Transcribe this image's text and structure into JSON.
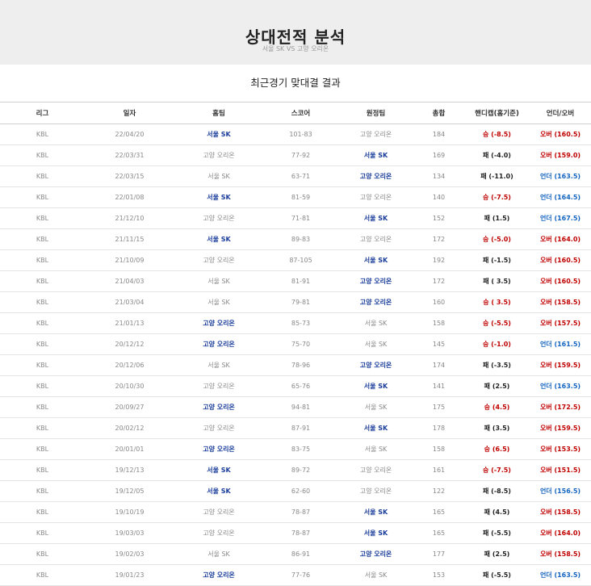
{
  "header": {
    "title": "상대전적 분석",
    "subtitle": "서울 SK VS 고양 오리온"
  },
  "section_title": "최근경기 맞대결 결과",
  "columns": [
    "리그",
    "일자",
    "홈팀",
    "스코어",
    "원정팀",
    "총합",
    "핸디캡(홈기준)",
    "언더/오버"
  ],
  "rows": [
    {
      "league": "KBL",
      "date": "22/04/20",
      "home": "서울 SK",
      "score": "101-83",
      "away": "고양 오리온",
      "total": "184",
      "hc": "승 (-8.5)",
      "ou": "오버 (160.5)",
      "winner": "home",
      "hcw": true,
      "over": true
    },
    {
      "league": "KBL",
      "date": "22/03/31",
      "home": "고양 오리온",
      "score": "77-92",
      "away": "서울 SK",
      "total": "169",
      "hc": "패 (-4.0)",
      "ou": "오버 (159.0)",
      "winner": "away",
      "hcw": false,
      "over": true
    },
    {
      "league": "KBL",
      "date": "22/03/15",
      "home": "서울 SK",
      "score": "63-71",
      "away": "고양 오리온",
      "total": "134",
      "hc": "패 (-11.0)",
      "ou": "언더 (163.5)",
      "winner": "away",
      "hcw": false,
      "over": false
    },
    {
      "league": "KBL",
      "date": "22/01/08",
      "home": "서울 SK",
      "score": "81-59",
      "away": "고양 오리온",
      "total": "140",
      "hc": "승 (-7.5)",
      "ou": "언더 (164.5)",
      "winner": "home",
      "hcw": true,
      "over": false
    },
    {
      "league": "KBL",
      "date": "21/12/10",
      "home": "고양 오리온",
      "score": "71-81",
      "away": "서울 SK",
      "total": "152",
      "hc": "패 (1.5)",
      "ou": "언더 (167.5)",
      "winner": "away",
      "hcw": false,
      "over": false
    },
    {
      "league": "KBL",
      "date": "21/11/15",
      "home": "서울 SK",
      "score": "89-83",
      "away": "고양 오리온",
      "total": "172",
      "hc": "승 (-5.0)",
      "ou": "오버 (164.0)",
      "winner": "home",
      "hcw": true,
      "over": true
    },
    {
      "league": "KBL",
      "date": "21/10/09",
      "home": "고양 오리온",
      "score": "87-105",
      "away": "서울 SK",
      "total": "192",
      "hc": "패 (-1.5)",
      "ou": "오버 (160.5)",
      "winner": "away",
      "hcw": false,
      "over": true
    },
    {
      "league": "KBL",
      "date": "21/04/03",
      "home": "서울 SK",
      "score": "81-91",
      "away": "고양 오리온",
      "total": "172",
      "hc": "패 ( 3.5)",
      "ou": "오버 (160.5)",
      "winner": "away",
      "hcw": false,
      "over": true
    },
    {
      "league": "KBL",
      "date": "21/03/04",
      "home": "서울 SK",
      "score": "79-81",
      "away": "고양 오리온",
      "total": "160",
      "hc": "승 ( 3.5)",
      "ou": "오버 (158.5)",
      "winner": "away",
      "hcw": true,
      "over": true
    },
    {
      "league": "KBL",
      "date": "21/01/13",
      "home": "고양 오리온",
      "score": "85-73",
      "away": "서울 SK",
      "total": "158",
      "hc": "승 (-5.5)",
      "ou": "오버 (157.5)",
      "winner": "home",
      "hcw": true,
      "over": true
    },
    {
      "league": "KBL",
      "date": "20/12/12",
      "home": "고양 오리온",
      "score": "75-70",
      "away": "서울 SK",
      "total": "145",
      "hc": "승 (-1.0)",
      "ou": "언더 (161.5)",
      "winner": "home",
      "hcw": true,
      "over": false
    },
    {
      "league": "KBL",
      "date": "20/12/06",
      "home": "서울 SK",
      "score": "78-96",
      "away": "고양 오리온",
      "total": "174",
      "hc": "패 (-3.5)",
      "ou": "오버 (159.5)",
      "winner": "away",
      "hcw": false,
      "over": true
    },
    {
      "league": "KBL",
      "date": "20/10/30",
      "home": "고양 오리온",
      "score": "65-76",
      "away": "서울 SK",
      "total": "141",
      "hc": "패 (2.5)",
      "ou": "언더 (163.5)",
      "winner": "away",
      "hcw": false,
      "over": false
    },
    {
      "league": "KBL",
      "date": "20/09/27",
      "home": "고양 오리온",
      "score": "94-81",
      "away": "서울 SK",
      "total": "175",
      "hc": "승 (4.5)",
      "ou": "오버 (172.5)",
      "winner": "home",
      "hcw": true,
      "over": true
    },
    {
      "league": "KBL",
      "date": "20/02/12",
      "home": "고양 오리온",
      "score": "87-91",
      "away": "서울 SK",
      "total": "178",
      "hc": "패 (3.5)",
      "ou": "오버 (159.5)",
      "winner": "away",
      "hcw": false,
      "over": true
    },
    {
      "league": "KBL",
      "date": "20/01/01",
      "home": "고양 오리온",
      "score": "83-75",
      "away": "서울 SK",
      "total": "158",
      "hc": "승 (6.5)",
      "ou": "오버 (153.5)",
      "winner": "home",
      "hcw": true,
      "over": true
    },
    {
      "league": "KBL",
      "date": "19/12/13",
      "home": "서울 SK",
      "score": "89-72",
      "away": "고양 오리온",
      "total": "161",
      "hc": "승 (-7.5)",
      "ou": "오버 (151.5)",
      "winner": "home",
      "hcw": true,
      "over": true
    },
    {
      "league": "KBL",
      "date": "19/12/05",
      "home": "서울 SK",
      "score": "62-60",
      "away": "고양 오리온",
      "total": "122",
      "hc": "패 (-8.5)",
      "ou": "언더 (156.5)",
      "winner": "home",
      "hcw": false,
      "over": false
    },
    {
      "league": "KBL",
      "date": "19/10/19",
      "home": "고양 오리온",
      "score": "78-87",
      "away": "서울 SK",
      "total": "165",
      "hc": "패 (4.5)",
      "ou": "오버 (158.5)",
      "winner": "away",
      "hcw": false,
      "over": true
    },
    {
      "league": "KBL",
      "date": "19/03/03",
      "home": "고양 오리온",
      "score": "78-87",
      "away": "서울 SK",
      "total": "165",
      "hc": "패 (-5.5)",
      "ou": "오버 (164.0)",
      "winner": "away",
      "hcw": false,
      "over": true
    },
    {
      "league": "KBL",
      "date": "19/02/03",
      "home": "서울 SK",
      "score": "86-91",
      "away": "고양 오리온",
      "total": "177",
      "hc": "패 (2.5)",
      "ou": "오버 (158.5)",
      "winner": "away",
      "hcw": false,
      "over": true
    },
    {
      "league": "KBL",
      "date": "19/01/23",
      "home": "고양 오리온",
      "score": "77-76",
      "away": "서울 SK",
      "total": "153",
      "hc": "패 (-5.5)",
      "ou": "언더 (163.5)",
      "winner": "home",
      "hcw": false,
      "over": false
    }
  ]
}
